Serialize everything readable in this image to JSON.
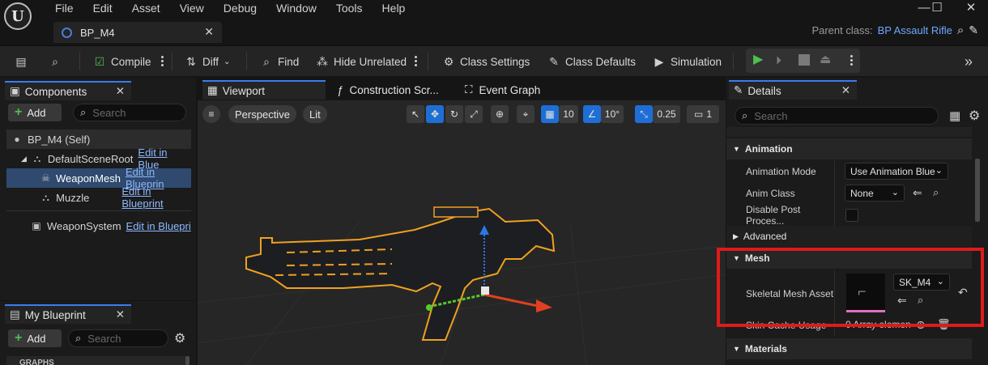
{
  "titlebar": {
    "logo": "U",
    "menu": [
      "File",
      "Edit",
      "Asset",
      "View",
      "Debug",
      "Window",
      "Tools",
      "Help"
    ],
    "tab_title": "BP_M4",
    "parent_class_label": "Parent class:",
    "parent_class_value": "BP Assault Rifle"
  },
  "toolbar": {
    "compile": "Compile",
    "diff": "Diff",
    "find": "Find",
    "hide_unrelated": "Hide Unrelated",
    "class_settings": "Class Settings",
    "class_defaults": "Class Defaults",
    "simulation": "Simulation"
  },
  "components": {
    "tab_label": "Components",
    "add_label": "Add",
    "search_placeholder": "Search",
    "items": [
      {
        "label": "BP_M4 (Self)",
        "link": ""
      },
      {
        "label": "DefaultSceneRoot",
        "link": "Edit in Blue"
      },
      {
        "label": "WeaponMesh",
        "link": "Edit in Blueprin"
      },
      {
        "label": "Muzzle",
        "link": "Edit in Blueprint"
      },
      {
        "label": "WeaponSystem",
        "link": "Edit in Bluepri"
      }
    ]
  },
  "my_blueprint": {
    "tab_label": "My Blueprint",
    "add_label": "Add",
    "search_placeholder": "Search",
    "section": "GRAPHS"
  },
  "editor_tabs": {
    "viewport": "Viewport",
    "construction": "Construction Scr...",
    "event_graph": "Event Graph"
  },
  "viewport": {
    "perspective": "Perspective",
    "lit": "Lit",
    "grid_size": "10",
    "rotation_snap": "10°",
    "scale_snap": "0.25",
    "camera_speed": "1"
  },
  "details": {
    "tab_label": "Details",
    "search_placeholder": "Search",
    "categories": {
      "animation": "Animation",
      "advanced": "Advanced",
      "mesh": "Mesh",
      "materials": "Materials"
    },
    "props": {
      "animation_mode_name": "Animation Mode",
      "animation_mode_value": "Use Animation Blue",
      "anim_class_name": "Anim Class",
      "anim_class_value": "None",
      "disable_post_name": "Disable Post Proces...",
      "skeletal_mesh_name": "Skeletal Mesh Asset",
      "skeletal_mesh_value": "SK_M4",
      "skin_cache_name": "Skin Cache Usage",
      "skin_cache_value": "0 Array elemen"
    }
  },
  "colors": {
    "accent_blue": "#1e6ed6",
    "selection": "#2f4a6e",
    "highlight_red": "#e01a1a",
    "outline_orange": "#f0a020",
    "play_green": "#4fbd4f"
  }
}
